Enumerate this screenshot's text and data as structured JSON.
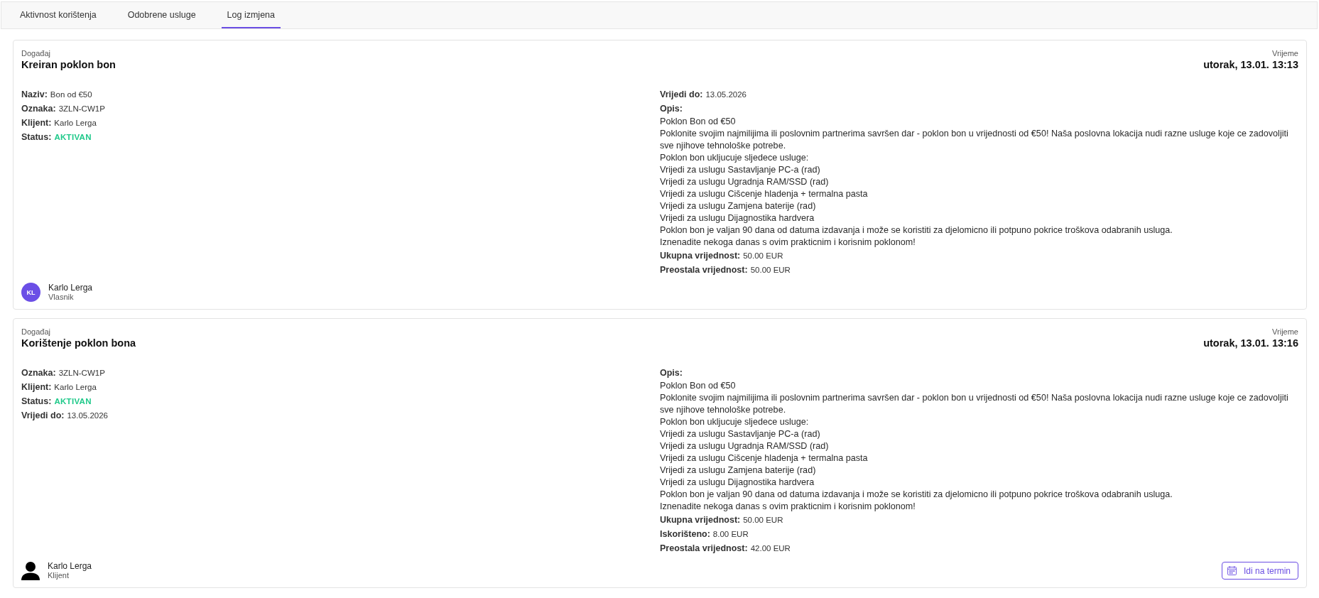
{
  "tabs": [
    {
      "label": "Aktivnost korištenja",
      "selected": false
    },
    {
      "label": "Odobrene usluge",
      "selected": false
    },
    {
      "label": "Log izmjena",
      "selected": true
    }
  ],
  "events": [
    {
      "event_label": "Događaj",
      "title": "Kreiran poklon bon",
      "time_label": "Vrijeme",
      "time": "utorak, 13.01. 13:13",
      "left_fields": [
        {
          "kind": "text",
          "label": "Naziv:",
          "value": "Bon od €50"
        },
        {
          "kind": "text",
          "label": "Oznaka:",
          "value": "3ZLN-CW1P"
        },
        {
          "kind": "text",
          "label": "Klijent:",
          "value": "Karlo Lerga"
        },
        {
          "kind": "status",
          "label": "Status:",
          "value": "AKTIVAN"
        }
      ],
      "right_fields": [
        {
          "kind": "text",
          "label": "Vrijedi do:",
          "value": "13.05.2026"
        },
        {
          "kind": "description",
          "label": "Opis:",
          "lines": [
            "Poklon Bon od €50",
            "Poklonite svojim najmilijima ili poslovnim partnerima savršen dar - poklon bon u vrijednosti od €50! Naša poslovna lokacija nudi razne usluge koje ce zadovoljiti sve njihove tehnološke potrebe.",
            "Poklon bon ukljucuje sljedece usluge:",
            "Vrijedi za uslugu Sastavljanje PC-a (rad)",
            "Vrijedi za uslugu Ugradnja RAM/SSD (rad)",
            "Vrijedi za uslugu Cišcenje hladenja + termalna pasta",
            "Vrijedi za uslugu Zamjena baterije (rad)",
            "Vrijedi za uslugu Dijagnostika hardvera",
            "Poklon bon je valjan 90 dana od datuma izdavanja i može se koristiti za djelomicno ili potpuno pokrice troškova odabranih usluga.",
            "Iznenadite nekoga danas s ovim prakticnim i korisnim poklonom!"
          ]
        },
        {
          "kind": "text",
          "label": "Ukupna vrijednost:",
          "value": "50.00 EUR"
        },
        {
          "kind": "text",
          "label": "Preostala vrijednost:",
          "value": "50.00 EUR"
        }
      ],
      "user": {
        "avatar": {
          "kind": "initials",
          "initials": "KL"
        },
        "name": "Karlo Lerga",
        "role": "Vlasnik"
      }
    },
    {
      "event_label": "Događaj",
      "title": "Korištenje poklon bona",
      "time_label": "Vrijeme",
      "time": "utorak, 13.01. 13:16",
      "left_fields": [
        {
          "kind": "text",
          "label": "Oznaka:",
          "value": "3ZLN-CW1P"
        },
        {
          "kind": "text",
          "label": "Klijent:",
          "value": "Karlo Lerga"
        },
        {
          "kind": "status",
          "label": "Status:",
          "value": "AKTIVAN"
        },
        {
          "kind": "text",
          "label": "Vrijedi do:",
          "value": "13.05.2026"
        }
      ],
      "right_fields": [
        {
          "kind": "description",
          "label": "Opis:",
          "lines": [
            "Poklon Bon od €50",
            "Poklonite svojim najmilijima ili poslovnim partnerima savršen dar - poklon bon u vrijednosti od €50! Naša poslovna lokacija nudi razne usluge koje ce zadovoljiti sve njihove tehnološke potrebe.",
            "Poklon bon ukljucuje sljedece usluge:",
            "Vrijedi za uslugu Sastavljanje PC-a (rad)",
            "Vrijedi za uslugu Ugradnja RAM/SSD (rad)",
            "Vrijedi za uslugu Cišcenje hladenja + termalna pasta",
            "Vrijedi za uslugu Zamjena baterije (rad)",
            "Vrijedi za uslugu Dijagnostika hardvera",
            "Poklon bon je valjan 90 dana od datuma izdavanja i može se koristiti za djelomicno ili potpuno pokrice troškova odabranih usluga.",
            "Iznenadite nekoga danas s ovim prakticnim i korisnim poklonom!"
          ]
        },
        {
          "kind": "text",
          "label": "Ukupna vrijednost:",
          "value": "50.00 EUR"
        },
        {
          "kind": "text",
          "label": "Iskorišteno:",
          "value": "8.00 EUR"
        },
        {
          "kind": "text",
          "label": "Preostala vrijednost:",
          "value": "42.00 EUR"
        }
      ],
      "user": {
        "avatar": {
          "kind": "silhouette"
        },
        "name": "Karlo Lerga",
        "role": "Klijent"
      },
      "action": {
        "label": "Idi na termin"
      }
    }
  ]
}
